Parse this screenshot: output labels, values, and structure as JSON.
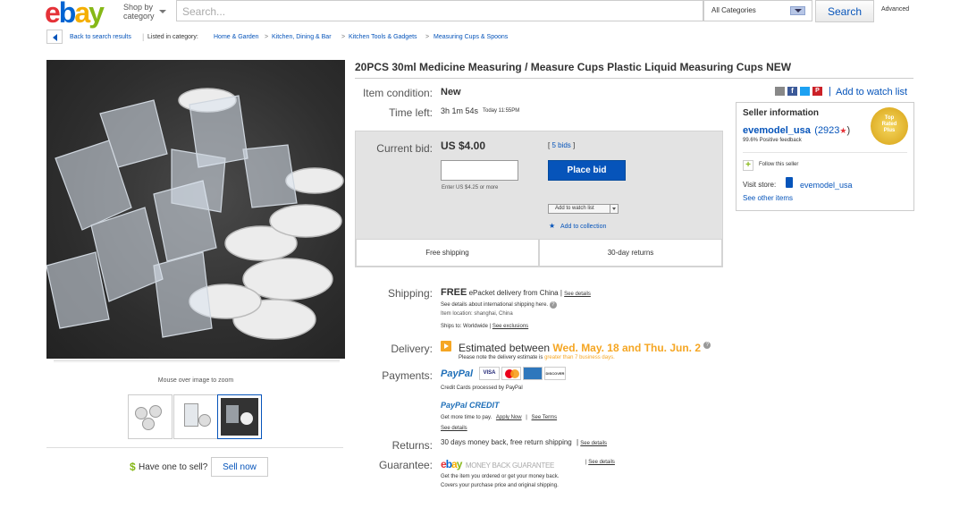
{
  "header": {
    "logo": "ebay",
    "logo_colors": [
      "#e53238",
      "#0064d2",
      "#f5af02",
      "#86b817"
    ],
    "shop_by_1": "Shop by",
    "shop_by_2": "category",
    "search_placeholder": "Search...",
    "category_select": "All Categories",
    "search_button": "Search",
    "advanced": "Advanced"
  },
  "breadcrumb": {
    "back": "Back to search results",
    "listed_in": "Listed in category:",
    "items": [
      "Home & Garden",
      "Kitchen, Dining & Bar",
      "Kitchen Tools & Gadgets",
      "Measuring Cups & Spoons"
    ],
    "separator": ">"
  },
  "gallery": {
    "zoom_hint": "Mouse over image to zoom",
    "have_one": "Have one to sell?",
    "sell_now": "Sell now"
  },
  "item": {
    "title": "20PCS 30ml Medicine Measuring / Measure Cups Plastic Liquid Measuring Cups NEW",
    "condition_label": "Item condition:",
    "condition": "New",
    "time_left_label": "Time left:",
    "time_left": "3h 1m 54s",
    "time_end": "Today 11:55PM",
    "current_bid_label": "Current bid:",
    "current_bid": "US $4.00",
    "bids": "5 bids",
    "bid_hint": "Enter US $4.25 or more",
    "place_bid": "Place bid",
    "add_watch": "Add to watch list",
    "add_collection": "Add to collection",
    "free_shipping": "Free shipping",
    "returns_30": "30-day returns"
  },
  "shipping": {
    "label": "Shipping:",
    "free": "FREE",
    "method": "ePacket delivery from China",
    "see_details": "See details",
    "intl": "See details about international shipping here.",
    "location": "Item location: shanghai, China",
    "ships_to": "Ships to: Worldwide",
    "see_exclusions": "See exclusions"
  },
  "delivery": {
    "label": "Delivery:",
    "estimated": "Estimated between",
    "dates": "Wed. May. 18 and Thu. Jun. 2",
    "note_1": "Please note the delivery estimate is",
    "note_2": "greater than 7 business days."
  },
  "payments": {
    "label": "Payments:",
    "paypal": "PayPal",
    "cards": [
      "VISA",
      "MC",
      "AMEX",
      "DISCOVER"
    ],
    "credit_processed": "Credit Cards processed by PayPal",
    "paypal_credit": "PayPal CREDIT",
    "more_time": "Get more time to pay.",
    "apply_now": "Apply Now",
    "see_terms": "See Terms",
    "see_details": "See details"
  },
  "returns": {
    "label": "Returns:",
    "text": "30 days money back, free return shipping",
    "see_details": "See details"
  },
  "guarantee": {
    "label": "Guarantee:",
    "badge_text": "MONEY BACK GUARANTEE",
    "see_details": "See details",
    "line1": "Get the item you ordered or get your money back.",
    "line2": "Covers your purchase price and original shipping."
  },
  "seller": {
    "watch_link": "Add to watch list",
    "heading": "Seller information",
    "name": "evemodel_usa",
    "score": "(2923",
    "score_end": ")",
    "feedback": "99.6% Positive feedback",
    "follow": "Follow this seller",
    "visit_store": "Visit store:",
    "store": "evemodel_usa",
    "other_items": "See other items",
    "badge_1": "Top",
    "badge_2": "Rated",
    "badge_3": "Plus"
  }
}
